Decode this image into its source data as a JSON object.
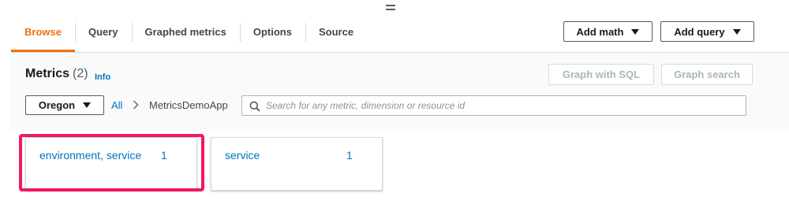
{
  "tabs": [
    {
      "label": "Browse",
      "active": true
    },
    {
      "label": "Query",
      "active": false
    },
    {
      "label": "Graphed metrics",
      "active": false
    },
    {
      "label": "Options",
      "active": false
    },
    {
      "label": "Source",
      "active": false
    }
  ],
  "toolbar": {
    "add_math_label": "Add math",
    "add_query_label": "Add query"
  },
  "metrics": {
    "title": "Metrics",
    "count": "(2)",
    "info_link": "Info",
    "graph_sql_label": "Graph with SQL",
    "graph_search_label": "Graph search"
  },
  "region": {
    "selected": "Oregon"
  },
  "breadcrumb": {
    "all": "All",
    "current": "MetricsDemoApp"
  },
  "search": {
    "placeholder": "Search for any metric, dimension or resource id",
    "value": ""
  },
  "dimension_cards": [
    {
      "label": "environment, service",
      "count": "1",
      "highlighted": true
    },
    {
      "label": "service",
      "count": "1",
      "highlighted": false
    }
  ],
  "colors": {
    "active_tab": "#ec7211",
    "link": "#0073bb",
    "highlight": "#f0195d",
    "border": "#545b64"
  },
  "icons": [
    "drag-handle-icon",
    "caret-down-icon",
    "chevron-right-icon",
    "search-icon"
  ]
}
